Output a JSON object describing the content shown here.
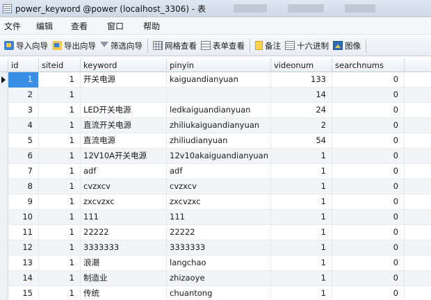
{
  "window": {
    "title": "power_keyword @power (localhost_3306) - 表"
  },
  "menu": [
    "文件",
    "编辑",
    "查看",
    "窗口",
    "帮助"
  ],
  "toolbar": {
    "import": "导入向导",
    "export": "导出向导",
    "filter": "筛选向导",
    "grid_view": "网格查看",
    "form_view": "表单查看",
    "memo": "备注",
    "hex": "十六进制",
    "image": "图像"
  },
  "columns": [
    "id",
    "siteid",
    "keyword",
    "pinyin",
    "videonum",
    "searchnums"
  ],
  "rows": [
    [
      "1",
      "1",
      "开关电源",
      "kaiguandianyuan",
      "133",
      "0"
    ],
    [
      "2",
      "1",
      "",
      "",
      "14",
      "0"
    ],
    [
      "3",
      "1",
      "LED开关电源",
      "ledkaiguandianyuan",
      "24",
      "0"
    ],
    [
      "4",
      "1",
      "直流开关电源",
      "zhiliukaiguandianyuan",
      "2",
      "0"
    ],
    [
      "5",
      "1",
      "直流电源",
      "zhiliudianyuan",
      "54",
      "0"
    ],
    [
      "6",
      "1",
      "12V10A开关电源",
      "12v10akaiguandianyuan",
      "1",
      "0"
    ],
    [
      "7",
      "1",
      "adf",
      "adf",
      "1",
      "0"
    ],
    [
      "8",
      "1",
      "cvzxcv",
      "cvzxcv",
      "1",
      "0"
    ],
    [
      "9",
      "1",
      "zxcvzxc",
      "zxcvzxc",
      "1",
      "0"
    ],
    [
      "10",
      "1",
      "111",
      "111",
      "1",
      "0"
    ],
    [
      "11",
      "1",
      "22222",
      "22222",
      "1",
      "0"
    ],
    [
      "12",
      "1",
      "3333333",
      "3333333",
      "1",
      "0"
    ],
    [
      "13",
      "1",
      "浪潮",
      "langchao",
      "1",
      "0"
    ],
    [
      "14",
      "1",
      "制造业",
      "zhizaoye",
      "1",
      "0"
    ],
    [
      "15",
      "1",
      "传统",
      "chuantong",
      "1",
      "0"
    ]
  ]
}
